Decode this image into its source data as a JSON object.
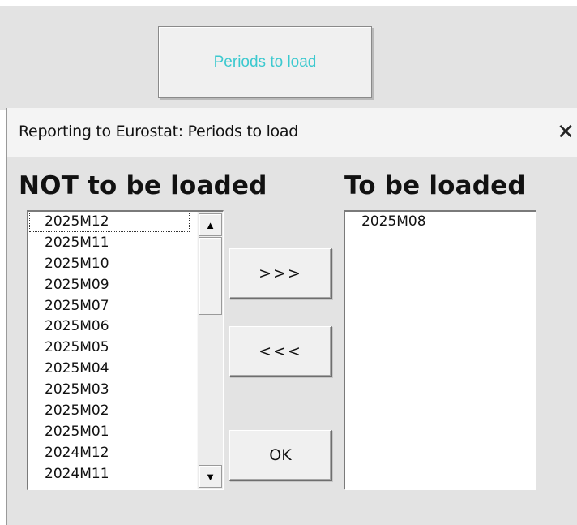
{
  "launcher": {
    "label": "Periods to load"
  },
  "dialog": {
    "title": "Reporting to Eurostat: Periods to load",
    "close_glyph": "✕"
  },
  "left_list": {
    "heading": "NOT to be loaded",
    "items": [
      "2025M12",
      "2025M11",
      "2025M10",
      "2025M09",
      "2025M07",
      "2025M06",
      "2025M05",
      "2025M04",
      "2025M03",
      "2025M02",
      "2025M01",
      "2024M12",
      "2024M11"
    ],
    "focused_index": 0,
    "scroll_up_icon": "triangle-up-icon",
    "scroll_down_icon": "triangle-down-icon"
  },
  "right_list": {
    "heading": "To be loaded",
    "items": [
      "2025M08"
    ]
  },
  "buttons": {
    "add_label": ">>>",
    "remove_label": "<<<",
    "ok_label": "OK"
  },
  "colors": {
    "launcher_text": "#3cc9cf",
    "dialog_bg": "#e3e3e3"
  }
}
